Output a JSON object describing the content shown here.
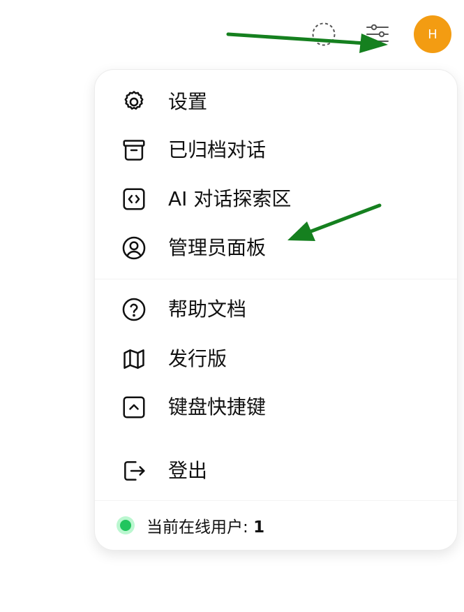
{
  "header": {
    "temp_chat_icon": "dashed-circle-icon",
    "controls_icon": "sliders-icon",
    "avatar_initial": "H"
  },
  "menu": {
    "groups": [
      [
        {
          "label": "设置",
          "icon": "gear-icon"
        },
        {
          "label": "已归档对话",
          "icon": "archive-icon"
        },
        {
          "label": "AI 对话探索区",
          "icon": "code-icon"
        },
        {
          "label": "管理员面板",
          "icon": "user-circle-icon"
        }
      ],
      [
        {
          "label": "帮助文档",
          "icon": "question-circle-icon"
        },
        {
          "label": "发行版",
          "icon": "map-icon"
        },
        {
          "label": "键盘快捷键",
          "icon": "keyboard-chevron-icon"
        }
      ],
      [
        {
          "label": "登出",
          "icon": "sign-out-icon"
        }
      ]
    ],
    "status": {
      "label": "当前在线用户: ",
      "count": "1"
    }
  },
  "colors": {
    "avatar_bg": "#f39c12",
    "status_green": "#22c55e",
    "status_green_outer": "#bbf7d0",
    "annotation_arrow": "#15801f"
  }
}
